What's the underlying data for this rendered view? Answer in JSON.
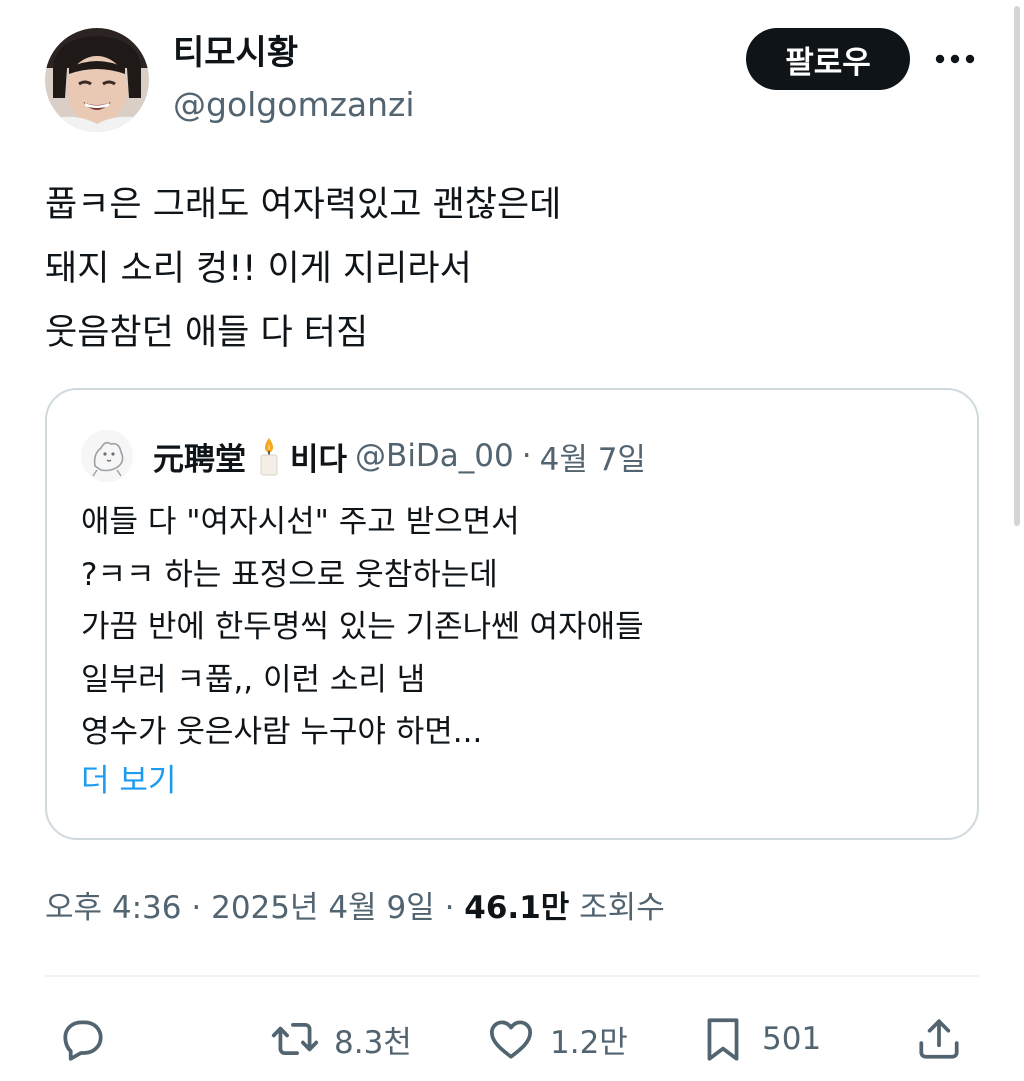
{
  "author": {
    "display_name": "티모시황",
    "handle": "@golgomzanzi"
  },
  "follow_button": {
    "label": "팔로우"
  },
  "more_button": {
    "icon": "more-horizontal-icon"
  },
  "tweet": {
    "lines": [
      "풉ㅋ은 그래도 여자력있고 괜찮은데",
      "돼지 소리 컹!! 이게 지리라서",
      "웃음참던 애들 다 터짐"
    ]
  },
  "quote": {
    "name": "元聘堂",
    "name_suffix": "비다",
    "handle": "@BiDa_00",
    "separator": "·",
    "date": "4월 7일",
    "lines": [
      "애들 다 \"여자시선\" 주고 받으면서",
      "?ㅋㅋ 하는 표정으로 웃참하는데",
      "가끔 반에 한두명씩 있는 기존나쎈 여자애들",
      "일부러 ㅋ풉,, 이런 소리 냄",
      "영수가 웃은사람 누구야 하면..."
    ],
    "show_more": "더 보기"
  },
  "meta": {
    "time": "오후 4:36",
    "separator": "·",
    "date": "2025년 4월 9일",
    "views_count": "46.1만",
    "views_label": "조회수"
  },
  "actions": {
    "reply": {
      "icon": "reply-icon"
    },
    "retweet": {
      "icon": "retweet-icon",
      "count": "8.3천"
    },
    "like": {
      "icon": "heart-icon",
      "count": "1.2만"
    },
    "bookmark": {
      "icon": "bookmark-icon",
      "count": "501"
    },
    "share": {
      "icon": "share-icon"
    }
  },
  "colors": {
    "text": "#0f1419",
    "secondary": "#536471",
    "accent": "#1d9bf0",
    "border": "#cfd9de",
    "follow_bg": "#0f1419"
  }
}
